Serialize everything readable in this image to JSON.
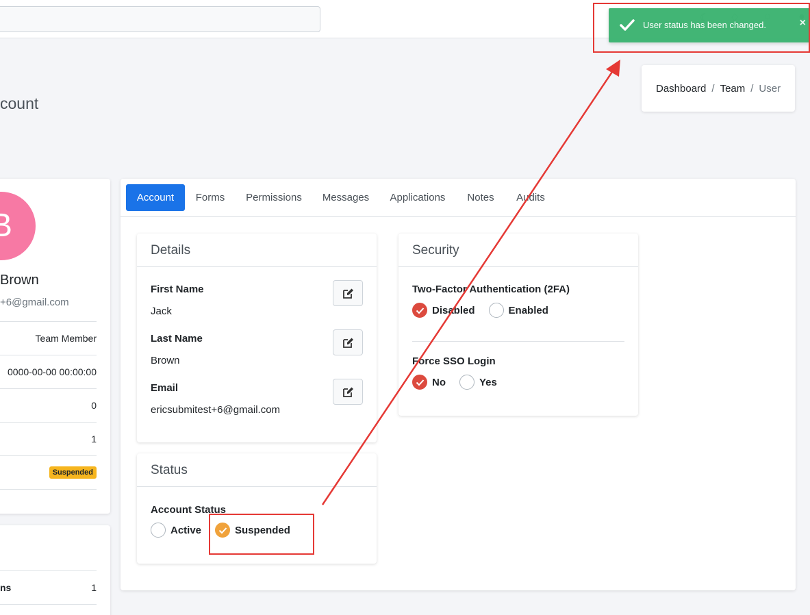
{
  "toast": {
    "message": "User status has been changed.",
    "close": "×",
    "color": "#3cb371"
  },
  "page": {
    "title_fragment": "count"
  },
  "breadcrumb": {
    "items": [
      "Dashboard",
      "Team",
      "User"
    ],
    "separator": "/"
  },
  "profile": {
    "avatar_letter": "B",
    "avatar_color": "#f779a4",
    "name": "Brown",
    "email": "+6@gmail.com",
    "rows": [
      "Team Member",
      "0000-00-00 00:00:00",
      "0",
      "1"
    ],
    "status_badge": "Suspended"
  },
  "profile2": {
    "row_label": "ns",
    "row_value": "1"
  },
  "tabs": [
    "Account",
    "Forms",
    "Permissions",
    "Messages",
    "Applications",
    "Notes",
    "Audits"
  ],
  "details": {
    "title": "Details",
    "first_name_label": "First Name",
    "first_name": "Jack",
    "last_name_label": "Last Name",
    "last_name": "Brown",
    "email_label": "Email",
    "email": "ericsubmitest+6@gmail.com"
  },
  "status": {
    "title": "Status",
    "label": "Account Status",
    "options": [
      "Active",
      "Suspended"
    ],
    "selected": "Suspended"
  },
  "security": {
    "title": "Security",
    "tfa_label": "Two-Factor Authentication (2FA)",
    "tfa_options": [
      "Disabled",
      "Enabled"
    ],
    "tfa_selected": "Disabled",
    "sso_label": "Force SSO Login",
    "sso_options": [
      "No",
      "Yes"
    ],
    "sso_selected": "No"
  },
  "icons": [
    "moon-icon",
    "bell-icon",
    "chat-icon",
    "user-icon",
    "check-icon",
    "edit-icon"
  ],
  "colors": {
    "primary": "#1a73e8",
    "danger": "#dc4a3e",
    "warning": "#f0a23b",
    "annotation": "#e53935"
  }
}
